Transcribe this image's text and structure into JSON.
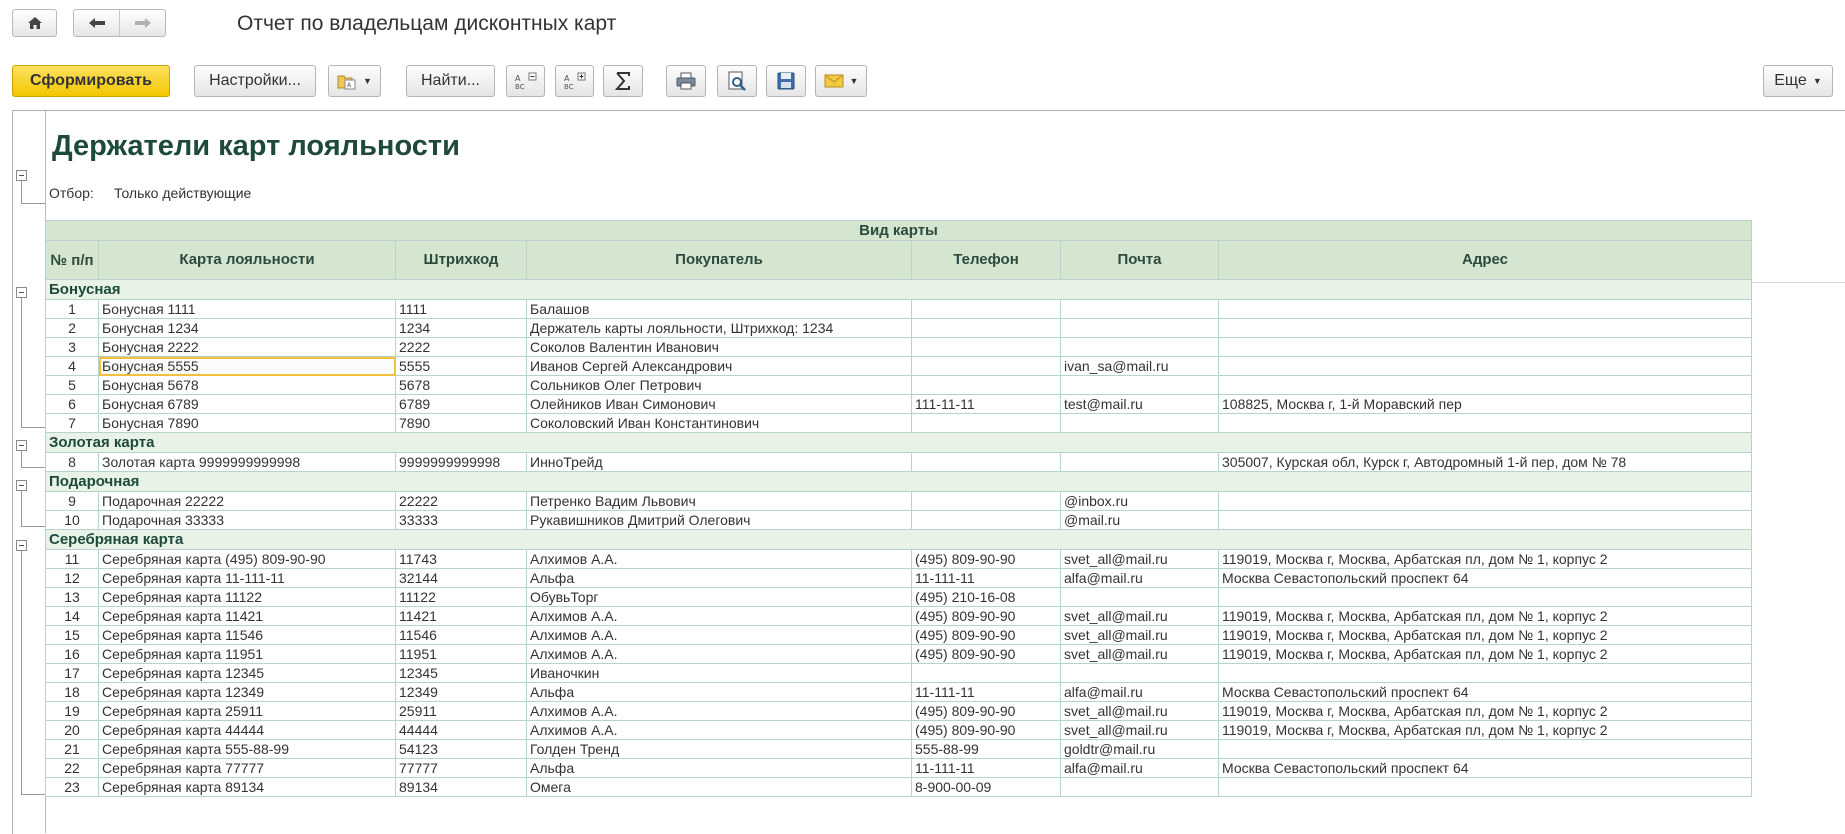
{
  "window": {
    "title": "Отчет по владельцам дисконтных карт"
  },
  "nav": {
    "home_icon": "home-icon",
    "back_icon": "arrow-left-icon",
    "forward_icon": "arrow-right-icon"
  },
  "toolbar": {
    "generate_label": "Сформировать",
    "settings_label": "Настройки...",
    "find_label": "Найти...",
    "more_label": "Еще"
  },
  "report": {
    "title": "Держатели карт лояльности",
    "filter_label": "Отбор:",
    "filter_value": "Только действующие",
    "header_group": "Вид карты",
    "columns": [
      "№ п/п",
      "Карта лояльности",
      "Штрихкод",
      "Покупатель",
      "Телефон",
      "Почта",
      "Адрес"
    ],
    "groups": [
      {
        "name": "Бонусная",
        "rows": [
          [
            "1",
            "Бонусная 1111",
            "1111",
            "Балашов",
            "",
            "",
            ""
          ],
          [
            "2",
            "Бонусная 1234",
            "1234",
            "Держатель карты лояльности, Штрихкод: 1234",
            "",
            "",
            ""
          ],
          [
            "3",
            "Бонусная 2222",
            "2222",
            "Соколов Валентин Иванович",
            "",
            "",
            ""
          ],
          [
            "4",
            "Бонусная 5555",
            "5555",
            "Иванов Сергей Александрович",
            "",
            "ivan_sa@mail.ru",
            ""
          ],
          [
            "5",
            "Бонусная 5678",
            "5678",
            "Сольников Олег Петрович",
            "",
            "",
            ""
          ],
          [
            "6",
            "Бонусная 6789",
            "6789",
            "Олейников Иван Симонович",
            "111-11-11",
            "test@mail.ru",
            "108825, Москва г, 1-й Моравский пер"
          ],
          [
            "7",
            "Бонусная 7890",
            "7890",
            "Соколовский Иван Константинович",
            "",
            "",
            ""
          ]
        ]
      },
      {
        "name": "Золотая карта",
        "rows": [
          [
            "8",
            "Золотая карта 9999999999998",
            "9999999999998",
            "ИнноТрейд",
            "",
            "",
            "305007, Курская обл, Курск г, Автодромный 1-й пер, дом № 78"
          ]
        ]
      },
      {
        "name": "Подарочная",
        "rows": [
          [
            "9",
            "Подарочная 22222",
            "22222",
            "Петренко Вадим Львович",
            "",
            "@inbox.ru",
            ""
          ],
          [
            "10",
            "Подарочная 33333",
            "33333",
            "Рукавишников Дмитрий Олегович",
            "",
            "@mail.ru",
            ""
          ]
        ]
      },
      {
        "name": "Серебряная карта",
        "rows": [
          [
            "11",
            "Серебряная карта (495) 809-90-90",
            "11743",
            "Алхимов А.А.",
            "(495) 809-90-90",
            "svet_all@mail.ru",
            "119019, Москва г, Москва, Арбатская пл, дом № 1, корпус 2"
          ],
          [
            "12",
            "Серебряная карта 11-111-11",
            "32144",
            "Альфа",
            "11-111-11",
            "alfa@mail.ru",
            "Москва Севастопольский проспект 64"
          ],
          [
            "13",
            "Серебряная карта 11122",
            "11122",
            "ОбувьТорг",
            "(495) 210-16-08",
            "",
            ""
          ],
          [
            "14",
            "Серебряная карта 11421",
            "11421",
            "Алхимов А.А.",
            "(495) 809-90-90",
            "svet_all@mail.ru",
            "119019, Москва г, Москва, Арбатская пл, дом № 1, корпус 2"
          ],
          [
            "15",
            "Серебряная карта 11546",
            "11546",
            "Алхимов А.А.",
            "(495) 809-90-90",
            "svet_all@mail.ru",
            "119019, Москва г, Москва, Арбатская пл, дом № 1, корпус 2"
          ],
          [
            "16",
            "Серебряная карта 11951",
            "11951",
            "Алхимов А.А.",
            "(495) 809-90-90",
            "svet_all@mail.ru",
            "119019, Москва г, Москва, Арбатская пл, дом № 1, корпус 2"
          ],
          [
            "17",
            "Серебряная карта 12345",
            "12345",
            "Иваночкин",
            "",
            "",
            ""
          ],
          [
            "18",
            "Серебряная карта 12349",
            "12349",
            "Альфа",
            "11-111-11",
            "alfa@mail.ru",
            "Москва Севастопольский проспект 64"
          ],
          [
            "19",
            "Серебряная карта 25911",
            "25911",
            "Алхимов А.А.",
            "(495) 809-90-90",
            "svet_all@mail.ru",
            "119019, Москва г, Москва, Арбатская пл, дом № 1, корпус 2"
          ],
          [
            "20",
            "Серебряная карта 44444",
            "44444",
            "Алхимов А.А.",
            "(495) 809-90-90",
            "svet_all@mail.ru",
            "119019, Москва г, Москва, Арбатская пл, дом № 1, корпус 2"
          ],
          [
            "21",
            "Серебряная карта 555-88-99",
            "54123",
            "Голден Тренд",
            "555-88-99",
            "goldtr@mail.ru",
            ""
          ],
          [
            "22",
            "Серебряная карта 77777",
            "77777",
            "Альфа",
            "11-111-11",
            "alfa@mail.ru",
            "Москва Севастопольский проспект 64"
          ],
          [
            "23",
            "Серебряная карта 89134",
            "89134",
            "Омега",
            "8-900-00-09",
            "",
            ""
          ]
        ]
      }
    ]
  },
  "colors": {
    "accent": "#f4c600",
    "header_bg": "#d4e6cf",
    "group_bg": "#e9f2e6",
    "title_color": "#1e4a3c",
    "grid_border": "#b9d2cb",
    "selection_border": "#efc13d"
  }
}
